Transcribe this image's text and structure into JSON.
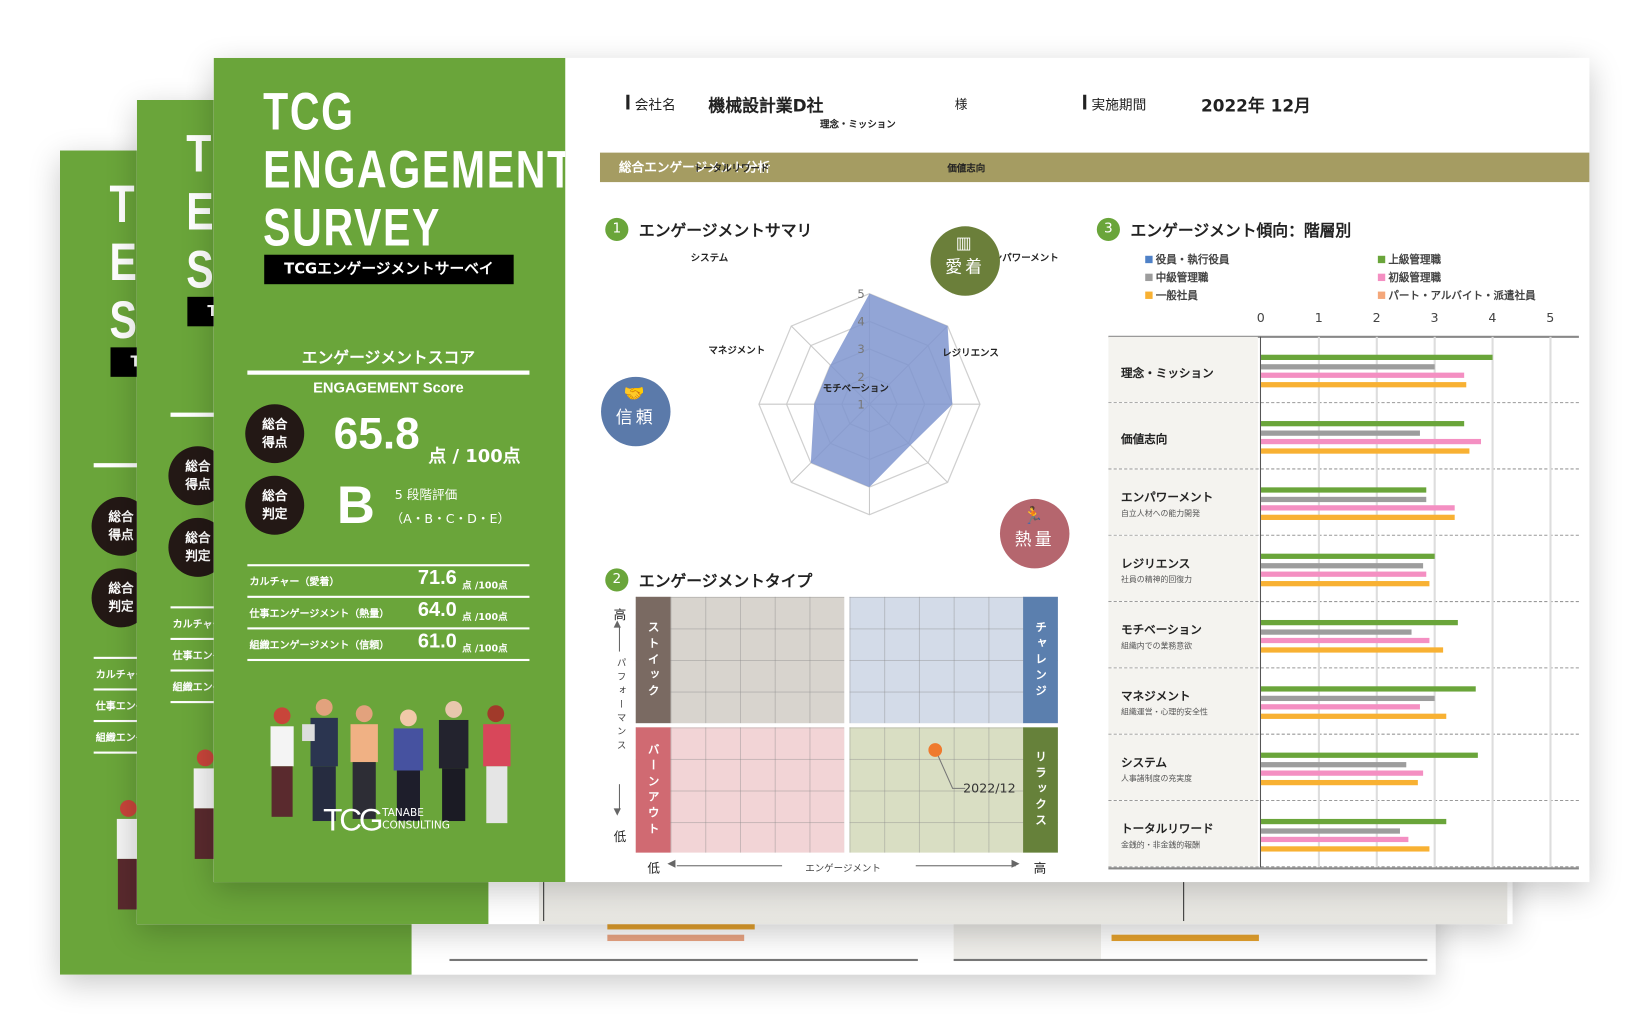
{
  "cover": {
    "title_lines": [
      "TCG",
      "ENGAGEMENT",
      "SURVEY"
    ],
    "subtitle": "TCGエンゲージメントサーベイ",
    "score_heading_jp": "エンゲージメントスコア",
    "score_heading_en": "ENGAGEMENT Score",
    "total_score_badge": [
      "総合",
      "得点"
    ],
    "total_score": "65.8",
    "total_score_unit": "点 / 100点",
    "grade_badge": [
      "総合",
      "判定"
    ],
    "grade": "B",
    "grade_scale": "5 段階評価",
    "grade_options": "（A・B・C・D・E）",
    "sub_scores": [
      {
        "label": "カルチャー（愛着）",
        "value": "71.6",
        "unit": "点 /100点"
      },
      {
        "label": "仕事エンゲージメント（熱量）",
        "value": "64.0",
        "unit": "点 /100点"
      },
      {
        "label": "組織エンゲージメント（信頼）",
        "value": "61.0",
        "unit": "点 /100点"
      }
    ],
    "logo": {
      "mark": "TCG",
      "name_line1": "TANABE",
      "name_line2": "CONSULTING"
    }
  },
  "header": {
    "company_label": "会社名",
    "company": "機械設計業D社",
    "honorific": "様",
    "period_label": "実施期間",
    "period": "2022年 12月"
  },
  "band_title": "総合エンゲージメント分析",
  "sections": [
    {
      "number": "1",
      "title": "エンゲージメントサマリ"
    },
    {
      "number": "2",
      "title": "エンゲージメントタイプ"
    },
    {
      "number": "3",
      "title": "エンゲージメント傾向：階層別"
    }
  ],
  "badges": {
    "attachment": "愛着",
    "trust": "信頼",
    "passion": "熱量"
  },
  "colors": {
    "green": "#6aa53a",
    "olive": "#a59c62",
    "radar_fill": "#7f95cf",
    "attachment": "#6b7f3a",
    "trust": "#5b7aaa",
    "passion": "#b5666e"
  },
  "quadrant": {
    "types": {
      "top_left": "ストイック",
      "top_right": "チャレンジ",
      "bottom_left": "バーンアウト",
      "bottom_right": "リラックス"
    },
    "y_axis": {
      "high": "高",
      "label": "パフォーマンス",
      "low": "低"
    },
    "x_axis": {
      "low": "低",
      "label": "エンゲージメント",
      "high": "高"
    },
    "point_label": "2022/12"
  },
  "chart_data": [
    {
      "type": "radar",
      "categories": [
        "理念・ミッション",
        "価値志向",
        "エンパワーメント",
        "レジリエンス",
        "モチベーション",
        "マネジメント",
        "システム",
        "トータルリワード"
      ],
      "values": [
        5,
        5,
        4,
        3.1,
        4,
        4,
        3,
        3
      ],
      "ticks": [
        "1",
        "2",
        "3",
        "4",
        "5"
      ],
      "range": [
        1,
        5
      ]
    },
    {
      "type": "scatter",
      "title": "エンゲージメントタイプ",
      "points": [
        {
          "label": "2022/12",
          "engagement": "high (relaxed quadrant)",
          "performance": "low-mid"
        }
      ]
    },
    {
      "type": "bar",
      "orientation": "horizontal",
      "xlim": [
        0,
        5
      ],
      "ticks": [
        "0",
        "1",
        "2",
        "3",
        "4",
        "5"
      ],
      "grid": true,
      "legend_position": "top",
      "categories": [
        {
          "label": "理念・ミッション",
          "sub": ""
        },
        {
          "label": "価値志向",
          "sub": ""
        },
        {
          "label": "エンパワーメント",
          "sub": "自立人材への能力開発"
        },
        {
          "label": "レジリエンス",
          "sub": "社員の精神的回復力"
        },
        {
          "label": "モチベーション",
          "sub": "組織内での業務意欲"
        },
        {
          "label": "マネジメント",
          "sub": "組織運営・心理的安全性"
        },
        {
          "label": "システム",
          "sub": "人事諸制度の充実度"
        },
        {
          "label": "トータルリワード",
          "sub": "金銭的・非金銭的報酬"
        }
      ],
      "series": [
        {
          "name": "役員・執行役員",
          "color": "#4f81c7",
          "values": null
        },
        {
          "name": "上級管理職",
          "color": "#6aa53a",
          "values": [
            4.0,
            3.5,
            2.85,
            3.0,
            3.4,
            3.7,
            3.75,
            3.2
          ]
        },
        {
          "name": "中級管理職",
          "color": "#9d9d9d",
          "values": [
            3.0,
            2.75,
            2.85,
            2.8,
            2.6,
            3.0,
            2.5,
            2.4
          ]
        },
        {
          "name": "初級管理職",
          "color": "#f48fc2",
          "values": [
            3.5,
            3.8,
            3.35,
            2.85,
            2.9,
            2.75,
            2.8,
            2.55
          ]
        },
        {
          "name": "一般社員",
          "color": "#f8b133",
          "values": [
            3.55,
            3.6,
            3.35,
            2.9,
            3.15,
            3.2,
            2.7,
            2.9
          ]
        },
        {
          "name": "パート・アルバイト・派遣社員",
          "color": "#f4a77a",
          "values": null
        }
      ]
    }
  ]
}
